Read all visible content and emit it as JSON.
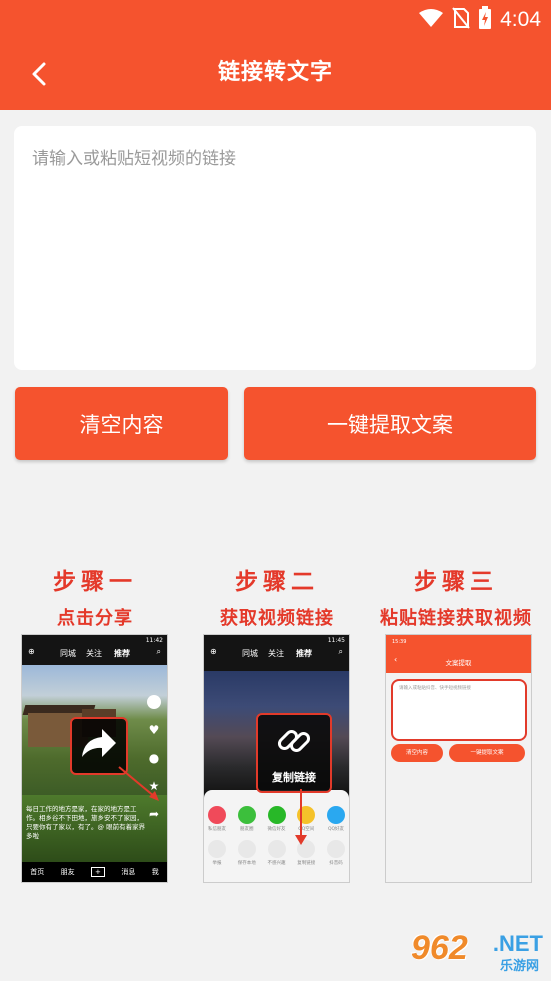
{
  "status": {
    "time": "4:04"
  },
  "header": {
    "title": "链接转文字"
  },
  "input": {
    "placeholder": "请输入或粘贴短视频的链接",
    "value": ""
  },
  "buttons": {
    "clear": "清空内容",
    "extract": "一键提取文案"
  },
  "steps": [
    {
      "title": "步骤一",
      "subtitle": "点击分享"
    },
    {
      "title": "步骤二",
      "subtitle": "获取视频链接"
    },
    {
      "title": "步骤三",
      "subtitle": "粘贴链接获取视频"
    }
  ],
  "shot1": {
    "time": "11:42",
    "tabs": [
      "同城",
      "关注",
      "推荐"
    ],
    "caption": "每日工作的地方是家，在家的地方是工作。相乡谷不下田地，旅乡安不了家园，只要你有了家以，有了。@ 眼前有着家界 多啦",
    "nav": [
      "首页",
      "朋友",
      "+",
      "消息",
      "我"
    ]
  },
  "shot2": {
    "time": "11:45",
    "tabs": [
      "同城",
      "关注",
      "推荐"
    ],
    "link_label": "复制链接",
    "row1": [
      "私信朋友",
      "朋友圈",
      "微信好友",
      "QQ空间",
      "QQ好友"
    ],
    "row2": [
      "举报",
      "保存本地",
      "不感兴趣",
      "复制链接",
      "抖音码"
    ]
  },
  "shot3": {
    "time": "15:39",
    "title": "文案提取",
    "placeholder": "请输入或粘贴抖音、快手短视频链接",
    "clear": "清空内容",
    "extract": "一键提取文案"
  },
  "watermark": {
    "number": "962",
    "net": ".NET",
    "cn": "乐游网"
  },
  "colors": {
    "brand": "#f5532e",
    "step_text": "#e4392a"
  }
}
